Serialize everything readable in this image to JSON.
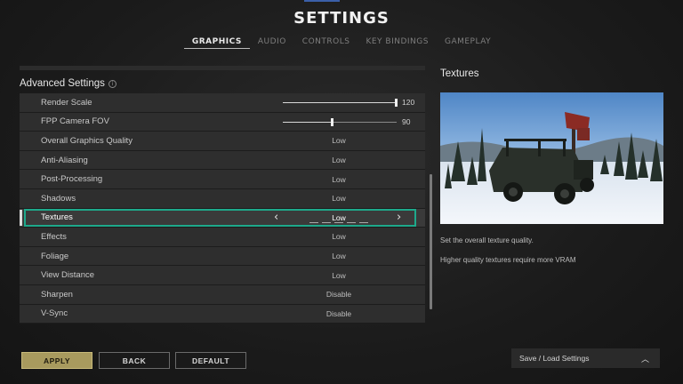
{
  "title": "SETTINGS",
  "tabs": [
    {
      "label": "GRAPHICS",
      "active": true
    },
    {
      "label": "AUDIO",
      "active": false
    },
    {
      "label": "CONTROLS",
      "active": false
    },
    {
      "label": "KEY BINDINGS",
      "active": false
    },
    {
      "label": "GAMEPLAY",
      "active": false
    }
  ],
  "section": {
    "title": "Advanced Settings",
    "info_icon": "info-circle-icon"
  },
  "settings": [
    {
      "label": "Render Scale",
      "type": "slider",
      "value": "120",
      "fraction": 0.99
    },
    {
      "label": "FPP Camera FOV",
      "type": "slider",
      "value": "90",
      "fraction": 0.43
    },
    {
      "label": "Overall Graphics Quality",
      "value": "Low"
    },
    {
      "label": "Anti-Aliasing",
      "value": "Low"
    },
    {
      "label": "Post-Processing",
      "value": "Low"
    },
    {
      "label": "Shadows",
      "value": "Low"
    },
    {
      "label": "Textures",
      "value": "Low",
      "selected": true
    },
    {
      "label": "Effects",
      "value": "Low"
    },
    {
      "label": "Foliage",
      "value": "Low"
    },
    {
      "label": "View Distance",
      "value": "Low"
    },
    {
      "label": "Sharpen",
      "value": "Disable"
    },
    {
      "label": "V-Sync",
      "value": "Disable"
    }
  ],
  "detail": {
    "title": "Textures",
    "desc1": "Set the overall texture quality.",
    "desc2": "Higher quality textures require more VRAM"
  },
  "buttons": {
    "apply": "APPLY",
    "back": "BACK",
    "default": "DEFAULT"
  },
  "save_load": {
    "label": "Save / Load Settings",
    "icon": "chevron-up-icon"
  },
  "colors": {
    "accent": "#1ea98b",
    "apply_bg": "#a89a5e"
  }
}
